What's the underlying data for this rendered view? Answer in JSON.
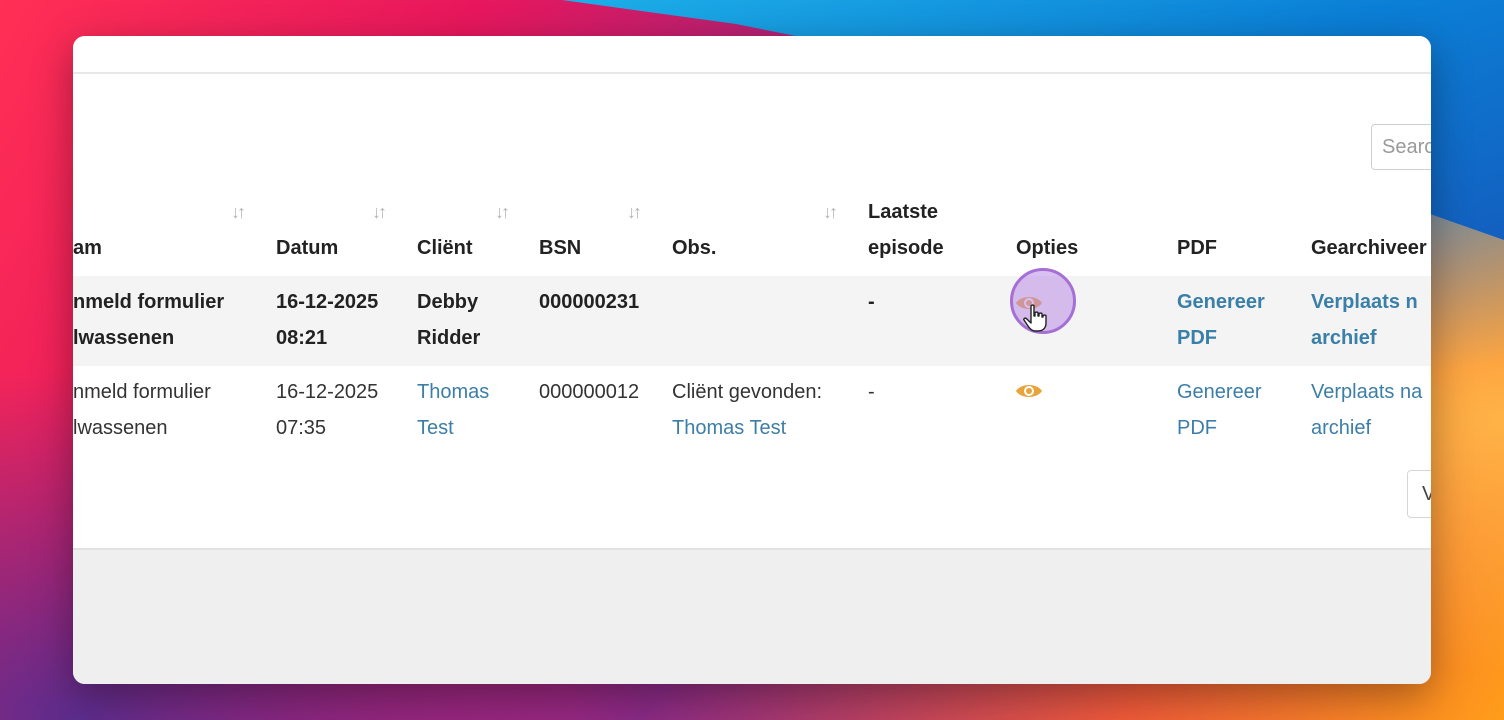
{
  "search": {
    "placeholder": "Searc"
  },
  "table": {
    "headers": {
      "naam": "am",
      "datum": "Datum",
      "client": "Cliënt",
      "bsn": "BSN",
      "obs": "Obs.",
      "laatste_line1": "Laatste",
      "laatste_line2": "episode",
      "opties": "Opties",
      "pdf": "PDF",
      "gearchiveerd": "Gearchiveer"
    },
    "sort_glyph": "↓↑",
    "rows": [
      {
        "naam_line1": "nmeld formulier",
        "naam_line2": "lwassenen",
        "datum_line1": "16-12-2025",
        "datum_line2": "08:21",
        "client_line1": "Debby",
        "client_line2": "Ridder",
        "bsn": "000000231",
        "obs_line1": "",
        "obs_line2": "",
        "laatste": "-",
        "pdf_line1": "Genereer",
        "pdf_line2": "PDF",
        "archief_line1": "Verplaats n",
        "archief_line2": "archief"
      },
      {
        "naam_line1": "nmeld formulier",
        "naam_line2": "lwassenen",
        "datum_line1": "16-12-2025",
        "datum_line2": "07:35",
        "client_line1": "Thomas",
        "client_line2": "Test",
        "bsn": "000000012",
        "obs_line1": "Cliënt gevonden:",
        "obs_line2": "Thomas Test",
        "laatste": "-",
        "pdf_line1": "Genereer",
        "pdf_line2": "PDF",
        "archief_line1": "Verplaats na",
        "archief_line2": "archief"
      }
    ]
  },
  "pager": {
    "button_text": "V"
  },
  "icons": {
    "view": "eye-icon",
    "sort": "sort-icon",
    "cursor": "hand-pointer-icon"
  },
  "colors": {
    "link": "#3c7ea8",
    "eye": "#e8a33a",
    "highlight": "#a56fd6"
  }
}
